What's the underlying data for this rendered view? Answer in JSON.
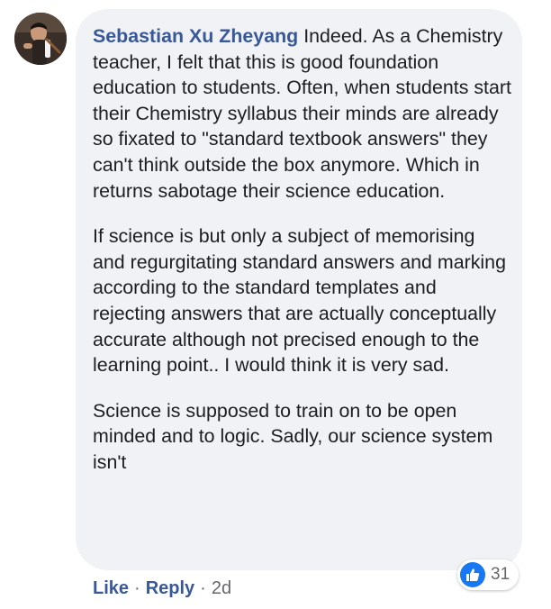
{
  "comment": {
    "author": "Sebastian Xu Zheyang",
    "paragraphs": [
      "Indeed. As a Chemistry teacher, I felt that this is good foundation education to students. Often, when students start their Chemistry syllabus their minds are already so fixated to \"standard textbook answers\" they can't think outside the box anymore. Which in returns sabotage their science education.",
      "If science is but only a subject of memorising and regurgitating standard answers and marking according to the standard templates and rejecting answers that are actually conceptually accurate although not precised enough to the learning point.. I would think it is very sad.",
      "Science is supposed to train on to be open minded and to logic. Sadly, our science system isn't"
    ],
    "reaction_count": "31",
    "reaction_icon": "like-thumbs-up-icon",
    "actions": {
      "like": "Like",
      "separator": "·",
      "reply": "Reply",
      "time": "2d"
    }
  },
  "colors": {
    "bubble": "#f0f2f5",
    "author": "#385898",
    "text": "#1c1e21",
    "like_blue": "#1877f2",
    "muted": "#65676b"
  }
}
